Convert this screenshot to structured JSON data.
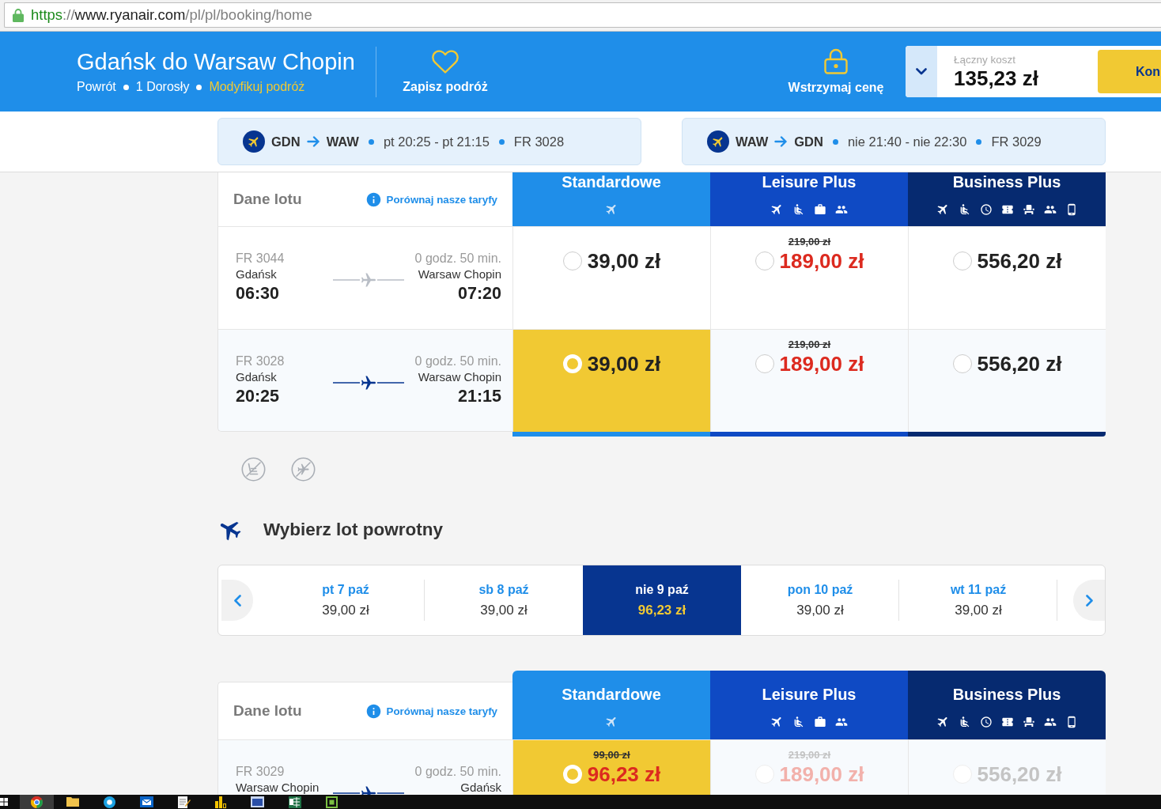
{
  "address_bar": {
    "url": {
      "scheme": "https",
      "separator": "://",
      "host": "www.ryanair.com",
      "path": "/pl/pl/booking/home"
    }
  },
  "trip_header": {
    "title": "Gdańsk do Warsaw Chopin",
    "trip_type": "Powrót",
    "passengers": "1 Dorosły",
    "modify_link": "Modyfikuj podróż",
    "save_button": "Zapisz podróż",
    "hold_button": "Wstrzymaj cenę",
    "total_label": "Łączny koszt",
    "total_value": "135,23 zł",
    "primary_button": "Kon"
  },
  "flight_summaries": [
    {
      "origin": "GDN",
      "destination": "WAW",
      "times": "pt 20:25 - pt 21:15",
      "flight": "FR 3028"
    },
    {
      "origin": "WAW",
      "destination": "GDN",
      "times": "nie 21:40 - nie 22:30",
      "flight": "FR 3029"
    }
  ],
  "outbound_table": {
    "details_label": "Dane lotu",
    "compare_link": "Porównaj nasze taryfy",
    "fare_columns": [
      {
        "name": "Standardowe",
        "kind": "standard"
      },
      {
        "name": "Leisure Plus",
        "kind": "leisure"
      },
      {
        "name": "Business Plus",
        "kind": "business"
      }
    ],
    "rows": [
      {
        "flight": "FR 3044",
        "from": "Gdańsk",
        "departure": "06:30",
        "duration": "0 godz. 50 min.",
        "to": "Warsaw Chopin",
        "arrival": "07:20",
        "selected": false,
        "fares": [
          {
            "price": "39,00 zł",
            "selected": false,
            "disabled": false
          },
          {
            "old_price": "219,00 zł",
            "price": "189,00 zł",
            "selected": false,
            "disabled": false
          },
          {
            "price": "556,20 zł",
            "selected": false,
            "disabled": false
          }
        ]
      },
      {
        "flight": "FR 3028",
        "from": "Gdańsk",
        "departure": "20:25",
        "duration": "0 godz. 50 min.",
        "to": "Warsaw Chopin",
        "arrival": "21:15",
        "selected": true,
        "fares": [
          {
            "price": "39,00 zł",
            "selected": true,
            "disabled": false
          },
          {
            "old_price": "219,00 zł",
            "price": "189,00 zł",
            "selected": false,
            "disabled": false
          },
          {
            "price": "556,20 zł",
            "selected": false,
            "disabled": false
          }
        ]
      }
    ]
  },
  "return_section": {
    "heading": "Wybierz lot powrotny",
    "dates": [
      {
        "day": "pt 7 paź",
        "price": "39,00 zł",
        "selected": false
      },
      {
        "day": "sb 8 paź",
        "price": "39,00 zł",
        "selected": false
      },
      {
        "day": "nie 9 paź",
        "price": "96,23 zł",
        "selected": true
      },
      {
        "day": "pon 10 paź",
        "price": "39,00 zł",
        "selected": false
      },
      {
        "day": "wt 11 paź",
        "price": "39,00 zł",
        "selected": false
      }
    ]
  },
  "return_table": {
    "details_label": "Dane lotu",
    "compare_link": "Porównaj nasze taryfy",
    "fare_columns": [
      {
        "name": "Standardowe",
        "kind": "standard"
      },
      {
        "name": "Leisure Plus",
        "kind": "leisure"
      },
      {
        "name": "Business Plus",
        "kind": "business"
      }
    ],
    "rows": [
      {
        "flight": "FR 3029",
        "from": "Warsaw Chopin",
        "duration": "0 godz. 50 min.",
        "to": "Gdańsk",
        "selected": true,
        "fares": [
          {
            "old_price": "99,00 zł",
            "price": "96,23 zł",
            "selected": true,
            "disabled": false
          },
          {
            "old_price": "219,00 zł",
            "price": "189,00 zł",
            "selected": false,
            "disabled": true
          },
          {
            "price": "556,20 zł",
            "selected": false,
            "disabled": true
          }
        ]
      }
    ]
  }
}
